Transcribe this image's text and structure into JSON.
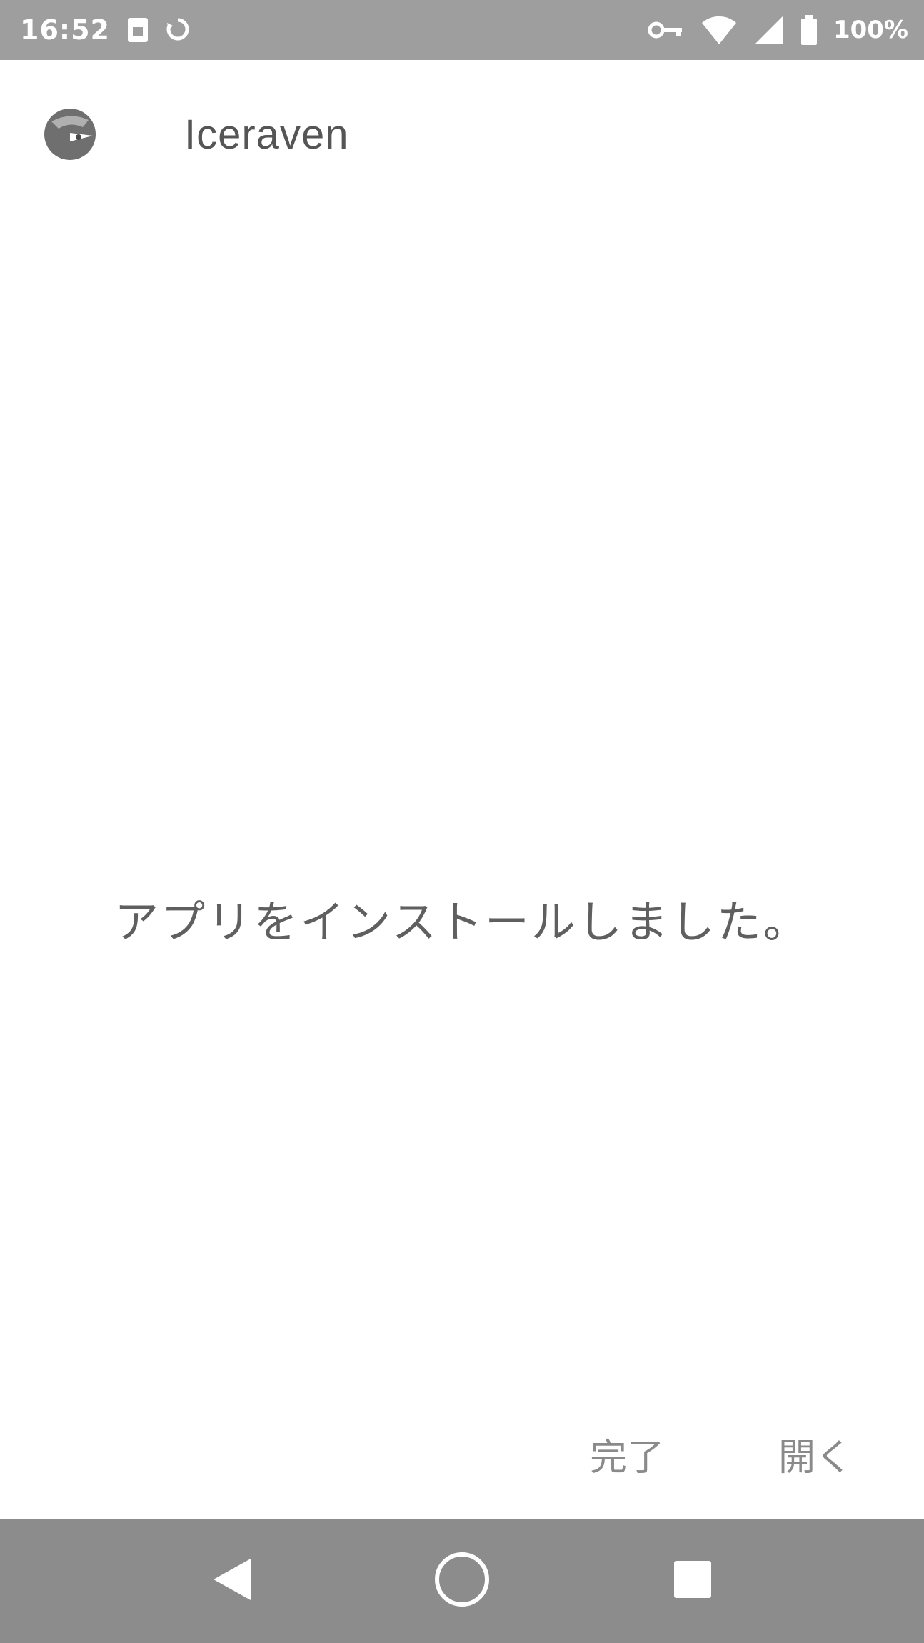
{
  "status_bar": {
    "time": "16:52",
    "notification_icons": [
      "sim-icon",
      "sync-icon"
    ],
    "system_icons": [
      "key-icon",
      "wifi-icon",
      "signal-icon",
      "battery-icon"
    ],
    "battery_text": "100%"
  },
  "header": {
    "app_name": "Iceraven",
    "logo_icon": "iceraven-logo-icon"
  },
  "main": {
    "message": "アプリをインストールしました。"
  },
  "actions": {
    "done_label": "完了",
    "open_label": "開く"
  },
  "nav_bar": {
    "back_icon": "back-triangle-icon",
    "home_icon": "home-circle-icon",
    "recents_icon": "recents-square-icon"
  },
  "colors": {
    "status_bar_bg": "#9e9e9e",
    "nav_bar_bg": "#8c8c8c",
    "text_gray": "#5f5f5f",
    "button_gray": "#8a8a8a"
  }
}
